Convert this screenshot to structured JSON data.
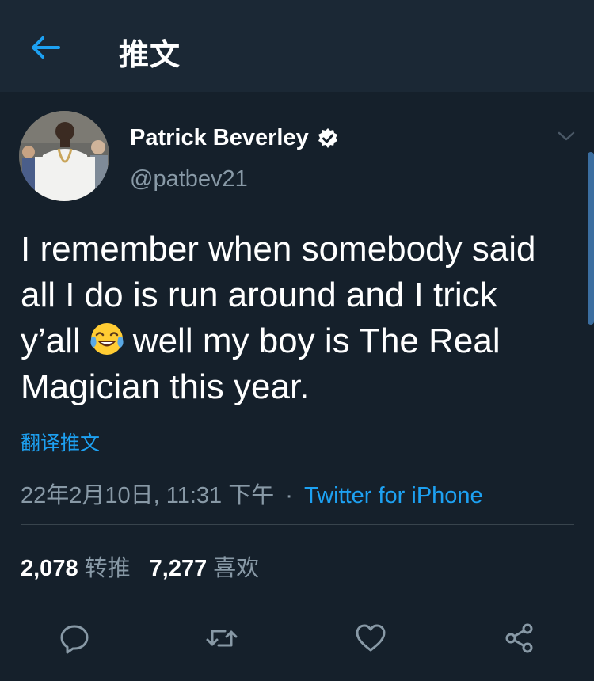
{
  "header": {
    "title": "推文",
    "back_icon": "arrow-left-icon"
  },
  "tweet": {
    "author_name": "Patrick Beverley",
    "author_handle": "@patbev21",
    "verified": true,
    "text_lines": [
      "I remember when somebody said",
      "all I do is run around and I trick",
      "y’all",
      "well my boy is The Real",
      "Magician this year."
    ],
    "emoji": "face-with-tears-of-joy",
    "translate_label": "翻译推文",
    "timestamp": "22年2月10日, 11:31 下午",
    "separator": "·",
    "source": "Twitter for iPhone"
  },
  "stats": {
    "retweets_count": "2,078",
    "retweets_label": "转推",
    "likes_count": "7,277",
    "likes_label": "喜欢"
  },
  "actions": [
    "reply-icon",
    "retweet-icon",
    "like-icon",
    "share-icon"
  ],
  "colors": {
    "background": "#15202b",
    "header_bg": "#1b2835",
    "accent": "#1da1f2",
    "secondary_text": "#8899a6",
    "divider": "#38444d"
  }
}
